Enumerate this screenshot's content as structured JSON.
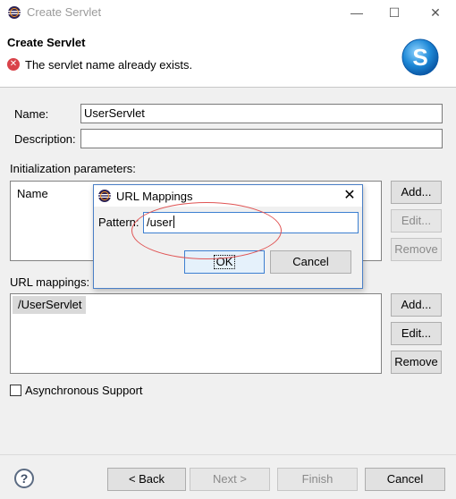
{
  "window": {
    "title": "Create Servlet",
    "minimize_glyph": "—",
    "maximize_glyph": "☐",
    "close_glyph": "✕"
  },
  "header": {
    "title": "Create Servlet",
    "error_message": "The servlet name already exists."
  },
  "form": {
    "name_label": "Name:",
    "name_value": "UserServlet",
    "description_label": "Description:",
    "description_value": "",
    "init_params_label": "Initialization parameters:",
    "init_params_column": "Name",
    "init_add": "Add...",
    "init_edit": "Edit...",
    "init_remove": "Remove",
    "url_mappings_label": "URL mappings:",
    "url_mappings_items": [
      "/UserServlet"
    ],
    "url_add": "Add...",
    "url_edit": "Edit...",
    "url_remove": "Remove",
    "async_label": "Asynchronous Support",
    "async_checked": false
  },
  "footer": {
    "back": "< Back",
    "next": "Next >",
    "finish": "Finish",
    "cancel": "Cancel"
  },
  "dialog": {
    "title": "URL Mappings",
    "pattern_label": "Pattern:",
    "pattern_value": "/user",
    "ok": "OK",
    "cancel": "Cancel"
  },
  "colors": {
    "error_red": "#d9434a",
    "accent_blue": "#3c7fd1",
    "annotation_red": "#e05454",
    "logo_blue": "#1e88d6"
  },
  "icons": [
    "eclipse-icon",
    "error-icon",
    "servlet-logo-icon",
    "help-icon",
    "close-icon"
  ]
}
